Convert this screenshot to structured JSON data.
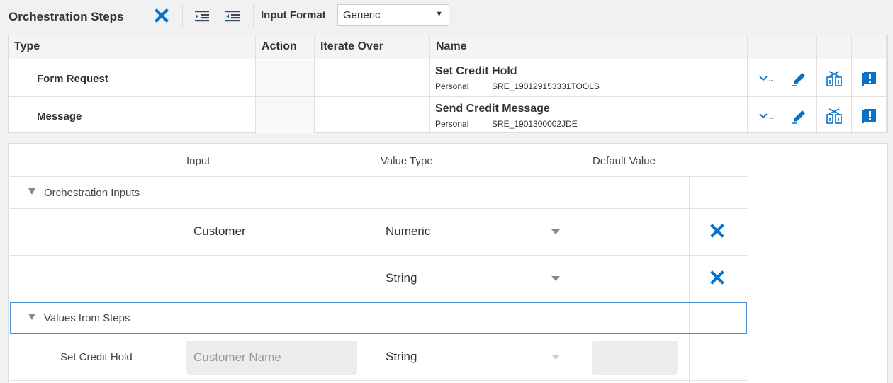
{
  "toolbar": {
    "title": "Orchestration Steps",
    "icons": [
      "delete-icon",
      "indent-icon",
      "outdent-icon"
    ],
    "input_format_label": "Input Format",
    "input_format_value": "Generic"
  },
  "steps_table": {
    "headers": [
      "Type",
      "Action",
      "Iterate Over",
      "Name"
    ],
    "rows": [
      {
        "type": "Form Request",
        "name": "Set Credit Hold",
        "scope": "Personal",
        "id": "SRE_190129153331TOOLS"
      },
      {
        "type": "Message",
        "name": "Send Credit Message",
        "scope": "Personal",
        "id": "SRE_1901300002JDE"
      }
    ],
    "row_icons": [
      "chevron-down-icon",
      "edit-pencil-icon",
      "transform-icon",
      "alert-icon"
    ]
  },
  "inputs_panel": {
    "headers": [
      "Input",
      "Value Type",
      "Default Value"
    ],
    "groups": {
      "orchestration_inputs": "Orchestration Inputs",
      "values_from_steps": "Values from Steps"
    },
    "orchestration_rows": [
      {
        "input": "Customer",
        "value_type": "Numeric"
      },
      {
        "input": "",
        "value_type": "String"
      }
    ],
    "step_rows": [
      {
        "step": "Set Credit Hold",
        "input_placeholder": "Customer Name",
        "value_type": "String"
      }
    ]
  },
  "colors": {
    "accent": "#0572ce",
    "border": "#dcdcdc",
    "group_border": "#4f8fd6"
  }
}
